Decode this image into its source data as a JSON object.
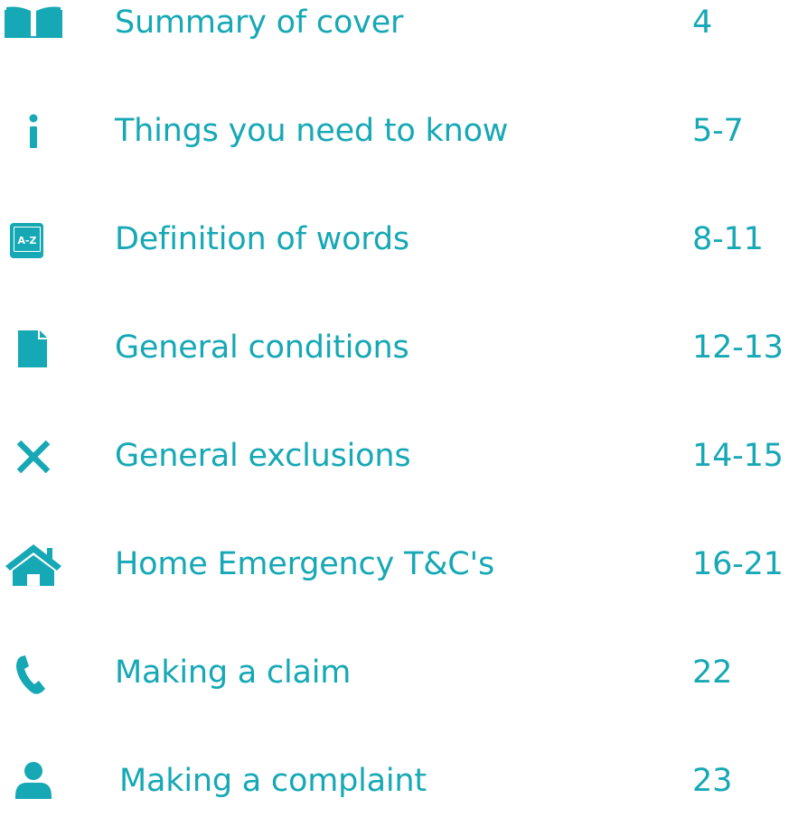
{
  "theme": {
    "accent": "#16a8b5"
  },
  "toc": {
    "items": [
      {
        "icon": "open-book-icon",
        "label": "Summary of cover",
        "pages": "4"
      },
      {
        "icon": "info-icon",
        "label": "Things you need to know",
        "pages": "5-7"
      },
      {
        "icon": "dictionary-icon",
        "label": "Definition of words",
        "pages": "8-11"
      },
      {
        "icon": "document-icon",
        "label": "General conditions",
        "pages": "12-13"
      },
      {
        "icon": "close-icon",
        "label": "General exclusions",
        "pages": "14-15"
      },
      {
        "icon": "home-icon",
        "label": "Home Emergency T&C's",
        "pages": "16-21"
      },
      {
        "icon": "phone-icon",
        "label": "Making a claim",
        "pages": "22"
      },
      {
        "icon": "person-icon",
        "label": "Making a complaint",
        "pages": "23"
      }
    ]
  }
}
